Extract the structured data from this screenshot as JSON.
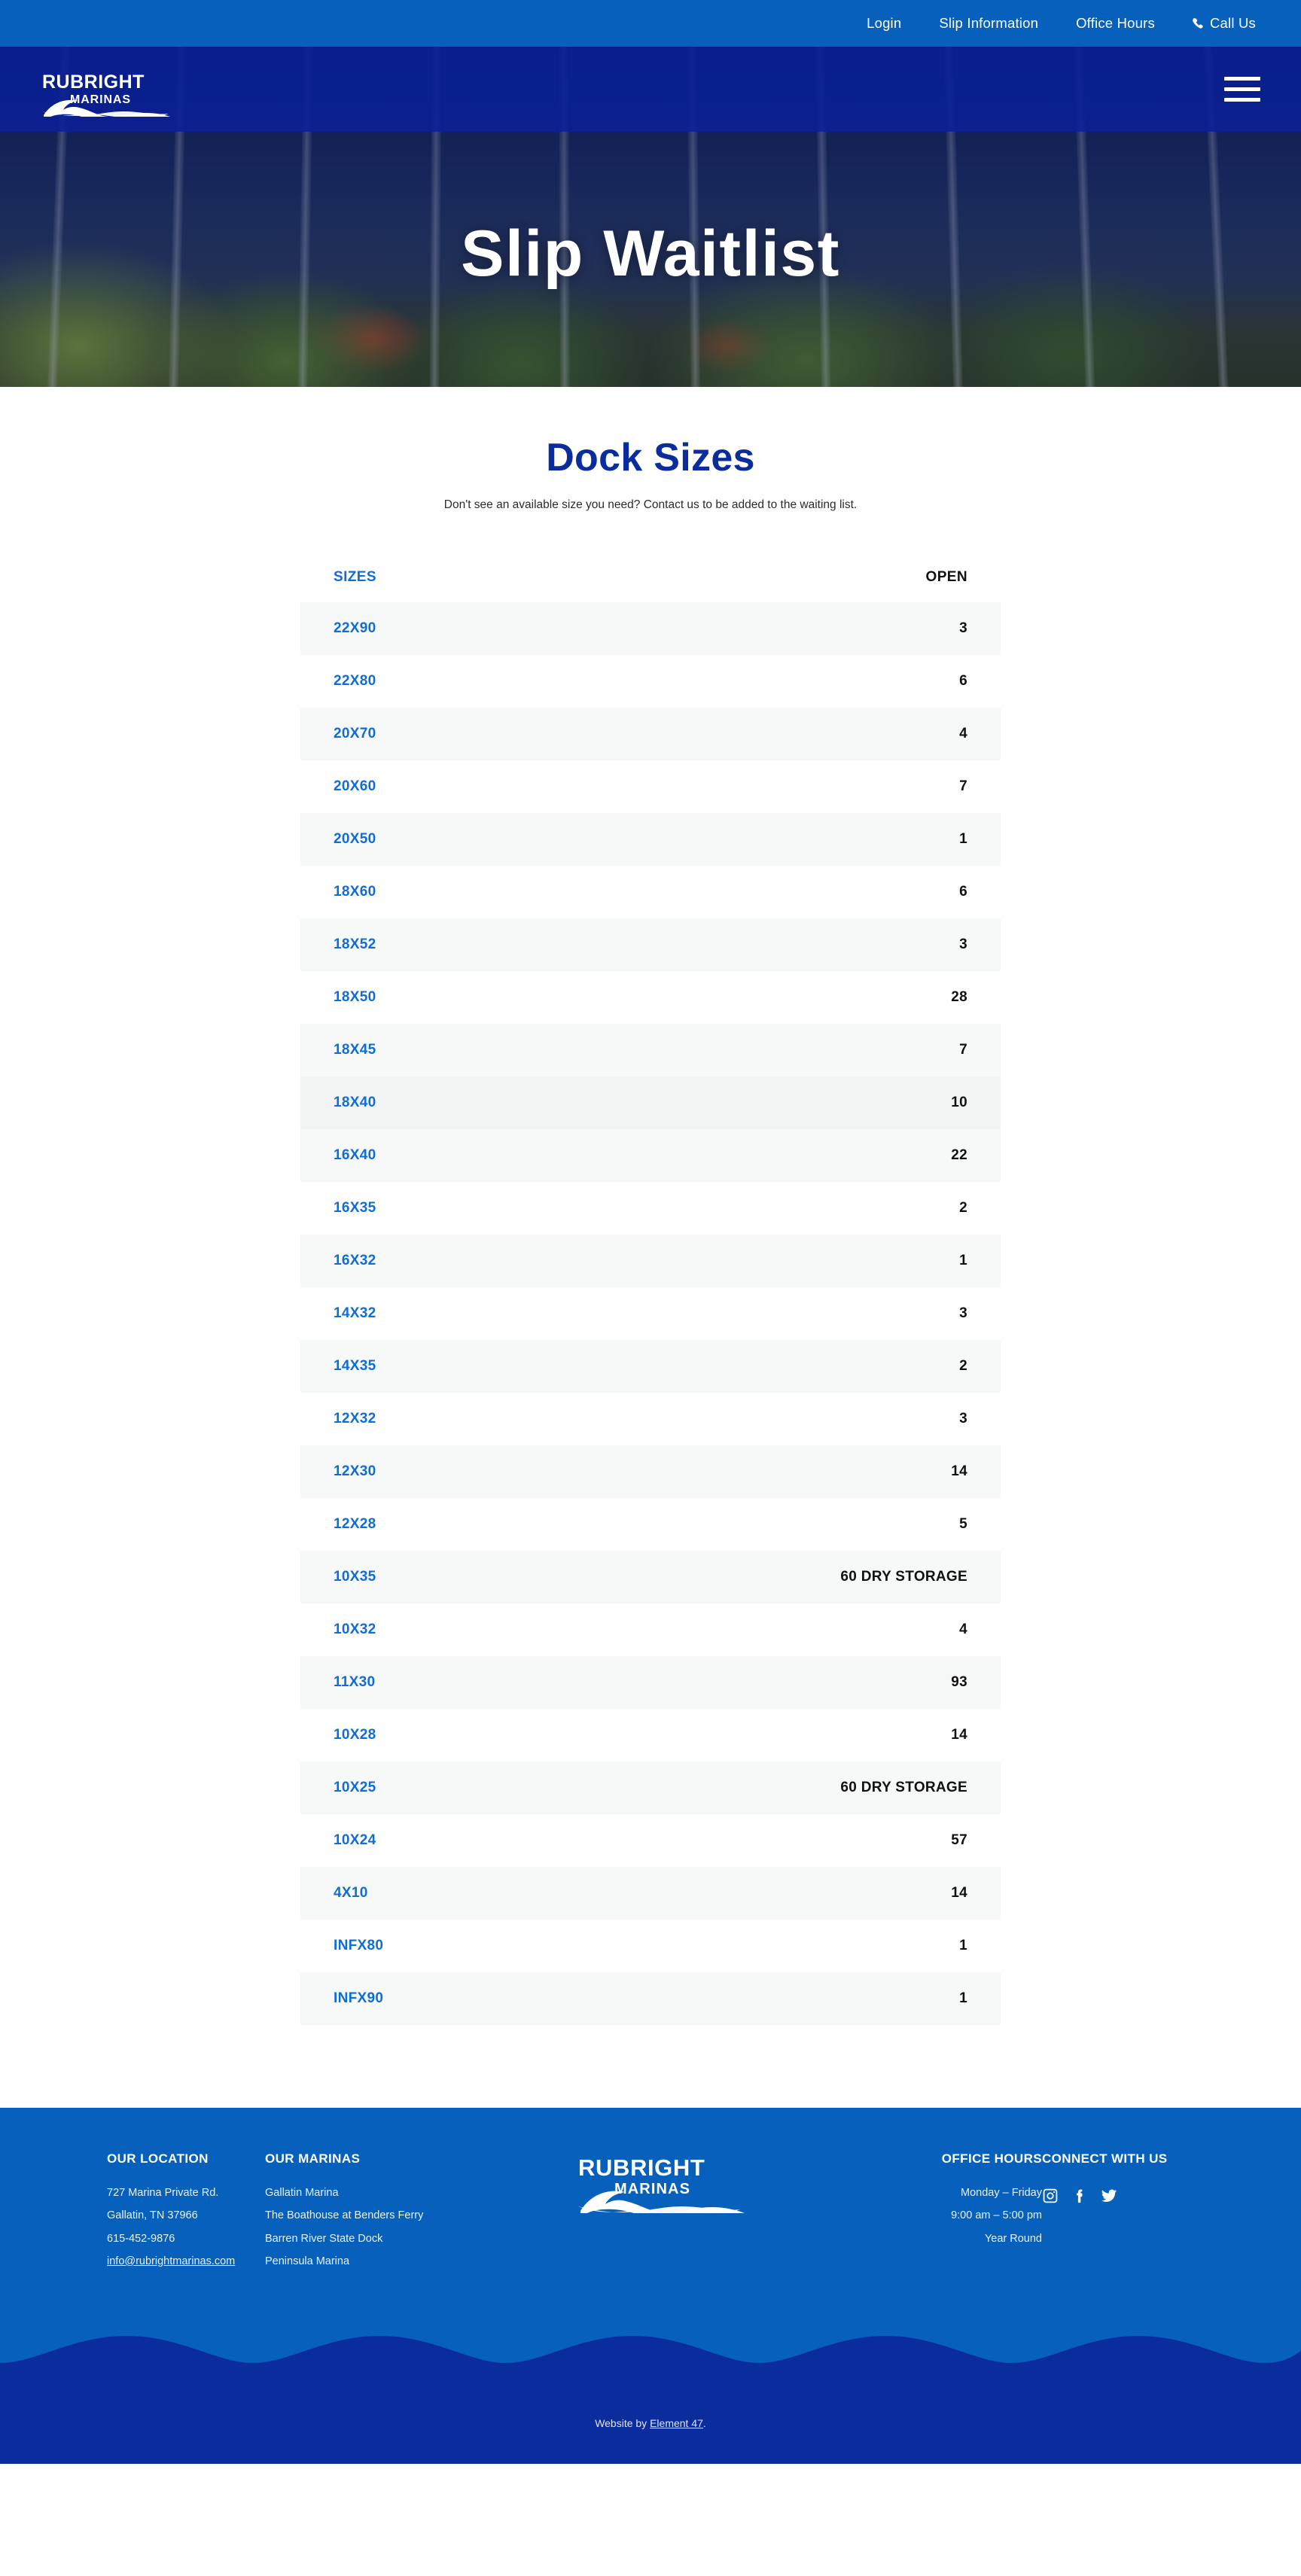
{
  "topbar": {
    "links": [
      {
        "label": "Login",
        "name": "login"
      },
      {
        "label": "Slip Information",
        "name": "slip-information"
      },
      {
        "label": "Office Hours",
        "name": "office-hours"
      }
    ],
    "call": {
      "label": "Call Us",
      "icon": "phone-icon"
    }
  },
  "header": {
    "logo_word": "RUBRIGHT",
    "logo_sub": "MARINAS",
    "menu_icon": "hamburger-menu-icon"
  },
  "hero": {
    "title": "Slip Waitlist"
  },
  "main": {
    "title": "Dock Sizes",
    "subtitle": "Don't see an available size you need? Contact us to be added to the waiting list."
  },
  "table": {
    "columns": [
      "SIZES",
      "OPEN"
    ],
    "rows": [
      {
        "size": "22X90",
        "open": "3"
      },
      {
        "size": "22X80",
        "open": "6"
      },
      {
        "size": "20X70",
        "open": "4"
      },
      {
        "size": "20X60",
        "open": "7"
      },
      {
        "size": "20X50",
        "open": "1"
      },
      {
        "size": "18X60",
        "open": "6"
      },
      {
        "size": "18X52",
        "open": "3"
      },
      {
        "size": "18X50",
        "open": "28"
      },
      {
        "size": "18X45",
        "open": "7"
      },
      {
        "size": "18X40",
        "open": "10"
      },
      {
        "size": "16X40",
        "open": "22"
      },
      {
        "size": "16X35",
        "open": "2"
      },
      {
        "size": "16X32",
        "open": "1"
      },
      {
        "size": "14X32",
        "open": "3"
      },
      {
        "size": "14X35",
        "open": "2"
      },
      {
        "size": "12X32",
        "open": "3"
      },
      {
        "size": "12X30",
        "open": "14"
      },
      {
        "size": "12X28",
        "open": "5"
      },
      {
        "size": "10X35",
        "open": "60 DRY STORAGE"
      },
      {
        "size": "10X32",
        "open": "4"
      },
      {
        "size": "11X30",
        "open": "93"
      },
      {
        "size": "10X28",
        "open": "14"
      },
      {
        "size": "10X25",
        "open": "60 DRY STORAGE"
      },
      {
        "size": "10X24",
        "open": "57"
      },
      {
        "size": "4X10",
        "open": "14"
      },
      {
        "size": "INFX80",
        "open": "1"
      },
      {
        "size": "INFX90",
        "open": "1"
      }
    ]
  },
  "footer": {
    "location": {
      "heading": "OUR LOCATION",
      "address1": "727 Marina Private Rd.",
      "address2": "Gallatin, TN 37966",
      "phone": "615-452-9876",
      "email": "info@rubrightmarinas.com"
    },
    "marinas": {
      "heading": "OUR MARINAS",
      "items": [
        "Gallatin Marina",
        "The Boathouse at Benders Ferry",
        "Barren River State Dock",
        "Peninsula Marina"
      ]
    },
    "logo_word": "RUBRIGHT",
    "logo_sub": "MARINAS",
    "hours": {
      "heading": "OFFICE HOURS",
      "line1": "Monday – Friday",
      "line2": "9:00 am – 5:00 pm",
      "line3": "Year Round"
    },
    "connect": {
      "heading": "CONNECT WITH US",
      "icons": [
        "instagram-icon",
        "facebook-icon",
        "twitter-icon"
      ]
    },
    "credit_prefix": "Website by ",
    "credit_link": "Element 47",
    "credit_suffix": "."
  },
  "colors": {
    "topbar_blue": "#0761BC",
    "navy": "#0B2C9C",
    "link_blue": "#0E6DD8",
    "row_alt": "#F7F8F8"
  }
}
